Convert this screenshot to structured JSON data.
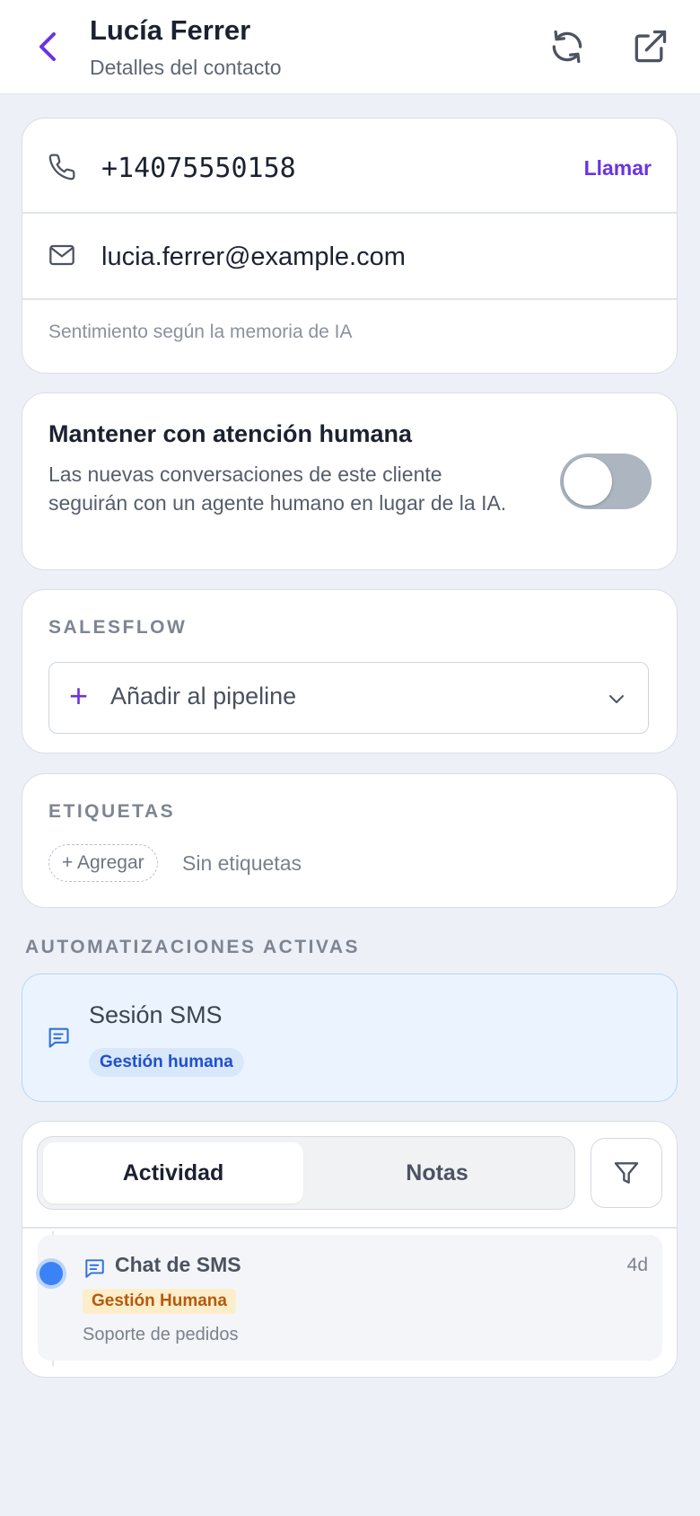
{
  "header": {
    "title": "Lucía Ferrer",
    "subtitle": "Detalles del contacto",
    "icons": {
      "back": "chevron-left-icon",
      "refresh": "refresh-icon",
      "open": "external-link-icon"
    }
  },
  "contact": {
    "phone": "+14075550158",
    "call_label": "Llamar",
    "email": "lucia.ferrer@example.com",
    "sentiment_placeholder": "Sentimiento según la memoria de IA"
  },
  "human_toggle": {
    "title": "Mantener con atención humana",
    "description": "Las nuevas conversaciones de este cliente seguirán con un agente humano en lugar de la IA.",
    "enabled": false
  },
  "salesflow": {
    "label": "SALESFLOW",
    "select_text": "Añadir al pipeline"
  },
  "tags": {
    "label": "ETIQUETAS",
    "add_label": "+ Agregar",
    "empty_text": "Sin etiquetas"
  },
  "automations": {
    "label": "AUTOMATIZACIONES ACTIVAS",
    "items": [
      {
        "title": "Sesión SMS",
        "badge": "Gestión humana"
      }
    ]
  },
  "activity": {
    "tabs": [
      {
        "label": "Actividad",
        "active": true
      },
      {
        "label": "Notas",
        "active": false
      }
    ],
    "items": [
      {
        "title": "Chat de SMS",
        "time": "4d",
        "badge": "Gestión Humana",
        "subtitle": "Soporte de pedidos"
      }
    ]
  },
  "colors": {
    "accent": "#6a34e0",
    "background": "#edf1f7",
    "automation_bg": "#ebf4fe",
    "timeline_dot": "#3b82f6",
    "badge_orange_bg": "#fdeecb"
  }
}
